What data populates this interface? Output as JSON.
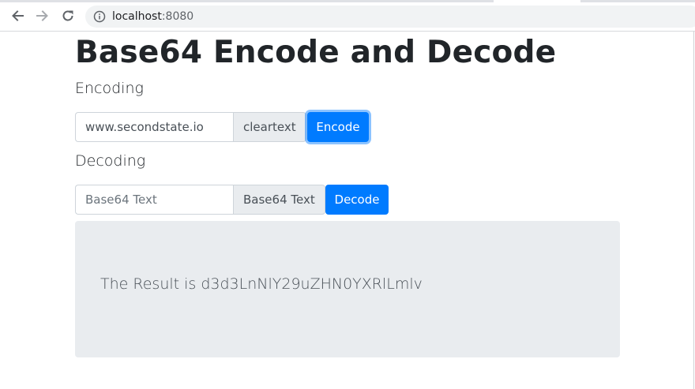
{
  "browser": {
    "url_host": "localhost",
    "url_port": ":8080",
    "icons": {
      "back": "arrow-left-icon",
      "forward": "arrow-right-icon",
      "reload": "reload-icon",
      "site_info": "info-icon"
    }
  },
  "page": {
    "title": "Base64 Encode and Decode"
  },
  "encoding": {
    "label": "Encoding",
    "input_value": "www.secondstate.io",
    "addon_label": "cleartext",
    "button_label": "Encode"
  },
  "decoding": {
    "label": "Decoding",
    "input_placeholder": "Base64 Text",
    "addon_label": "Base64 Text",
    "button_label": "Decode"
  },
  "result": {
    "text": "The Result is d3d3LnNlY29uZHN0YXRlLmlv"
  },
  "colors": {
    "primary": "#007bff",
    "result_background": "#e9ecef"
  }
}
